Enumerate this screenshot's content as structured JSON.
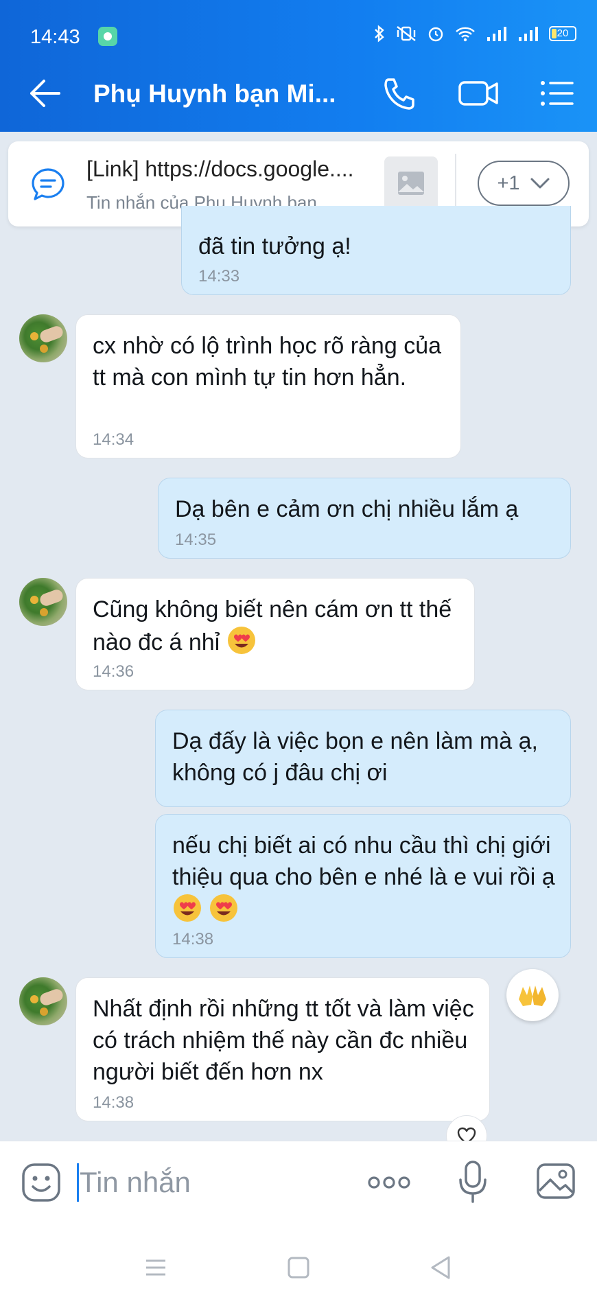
{
  "status_bar": {
    "time": "14:43",
    "battery": "20"
  },
  "header": {
    "title": "Phụ Huynh bạn Mi..."
  },
  "pinned": {
    "title": "[Link] https://docs.google....",
    "subtitle": "Tin nhắn của Phụ Huynh bạn...",
    "more_label": "+1"
  },
  "messages": [
    {
      "direction": "out",
      "text": "đã tin tưởng ạ!",
      "time": "14:33"
    },
    {
      "direction": "in",
      "text": "cx nhờ có lộ trình học rõ ràng của tt mà con mình tự tin hơn hẳn.",
      "time": "14:34"
    },
    {
      "direction": "out",
      "text": "Dạ bên e cảm ơn chị nhiều lắm ạ",
      "time": "14:35"
    },
    {
      "direction": "in",
      "text": "Cũng không biết nên cám ơn tt thế nào đc á nhỉ",
      "time": "14:36"
    },
    {
      "direction": "out",
      "text": "Dạ đấy là việc bọn e nên làm mà ạ, không có j đâu chị ơi",
      "time": ""
    },
    {
      "direction": "out",
      "text": "nếu chị biết ai có nhu cầu thì chị giới thiệu qua cho bên e nhé là e vui rồi ạ",
      "time": "14:38"
    },
    {
      "direction": "in",
      "text": "Nhất định rồi những tt tốt và làm việc có trách nhiệm thế này cần đc nhiều người biết đến hơn nx",
      "time": "14:38"
    }
  ],
  "composer": {
    "placeholder": "Tin nhắn"
  },
  "icons": {
    "back": "arrow-left-icon",
    "call": "phone-icon",
    "video": "video-camera-icon",
    "menu": "list-menu-icon",
    "emoji": "smiley-icon",
    "more": "more-dots-icon",
    "mic": "microphone-icon",
    "gallery": "image-icon"
  },
  "colors": {
    "header_blue": "#127ef0",
    "bubble_out": "#d5ecfc",
    "bubble_in": "#ffffff",
    "background": "#e2e9f1"
  }
}
